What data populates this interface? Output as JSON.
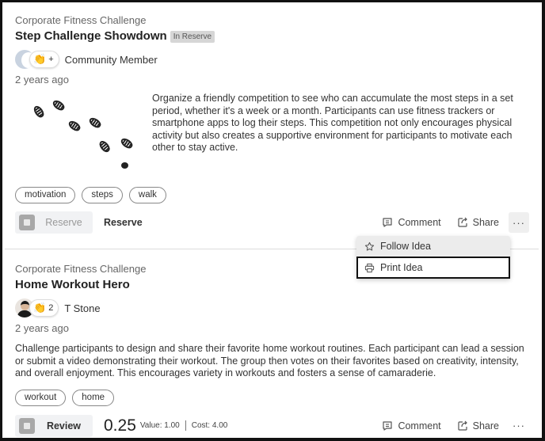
{
  "ideas": [
    {
      "category": "Corporate Fitness Challenge",
      "title": "Step Challenge Showdown",
      "badge": "In Reserve",
      "clap_count": "+",
      "author": "Community Member",
      "time": "2 years ago",
      "image": "footprints-illustration",
      "description": "Organize a friendly competition to see who can accumulate the most steps in a set period, whether it's a week or a month. Participants can use fitness trackers or smartphone apps to log their steps. This competition not only encourages physical activity but also creates a supportive environment for participants to motivate each other to stay active.",
      "tags": [
        "motivation",
        "steps",
        "walk"
      ],
      "stage_button": "Reserve",
      "stage_text": "Reserve",
      "actions": {
        "comment": "Comment",
        "share": "Share",
        "more": "···"
      }
    },
    {
      "category": "Corporate Fitness Challenge",
      "title": "Home Workout Hero",
      "clap_count": "2",
      "author": "T Stone",
      "time": "2 years ago",
      "description": "Challenge participants to design and share their favorite home workout routines. Each participant can lead a session or submit a video demonstrating their workout. The group then votes on their favorites based on creativity, intensity, and overall enjoyment. This encourages variety in workouts and fosters a sense of camaraderie.",
      "tags": [
        "workout",
        "home"
      ],
      "stage_button": "Review",
      "score": "0.25",
      "value_label": "Value: 1.00",
      "cost_label": "Cost: 4.00",
      "actions": {
        "comment": "Comment",
        "share": "Share",
        "more": "···"
      }
    }
  ],
  "more_menu": {
    "items": [
      {
        "label": "Follow Idea",
        "icon": "star-icon",
        "state": "hover"
      },
      {
        "label": "Print Idea",
        "icon": "printer-icon",
        "state": "focused"
      }
    ]
  },
  "colors": {
    "badge_bg": "#d6d6d6",
    "stage_bg": "#f1f2f4",
    "stage_icon": "#a8a8a8",
    "focus_border": "#111111"
  }
}
